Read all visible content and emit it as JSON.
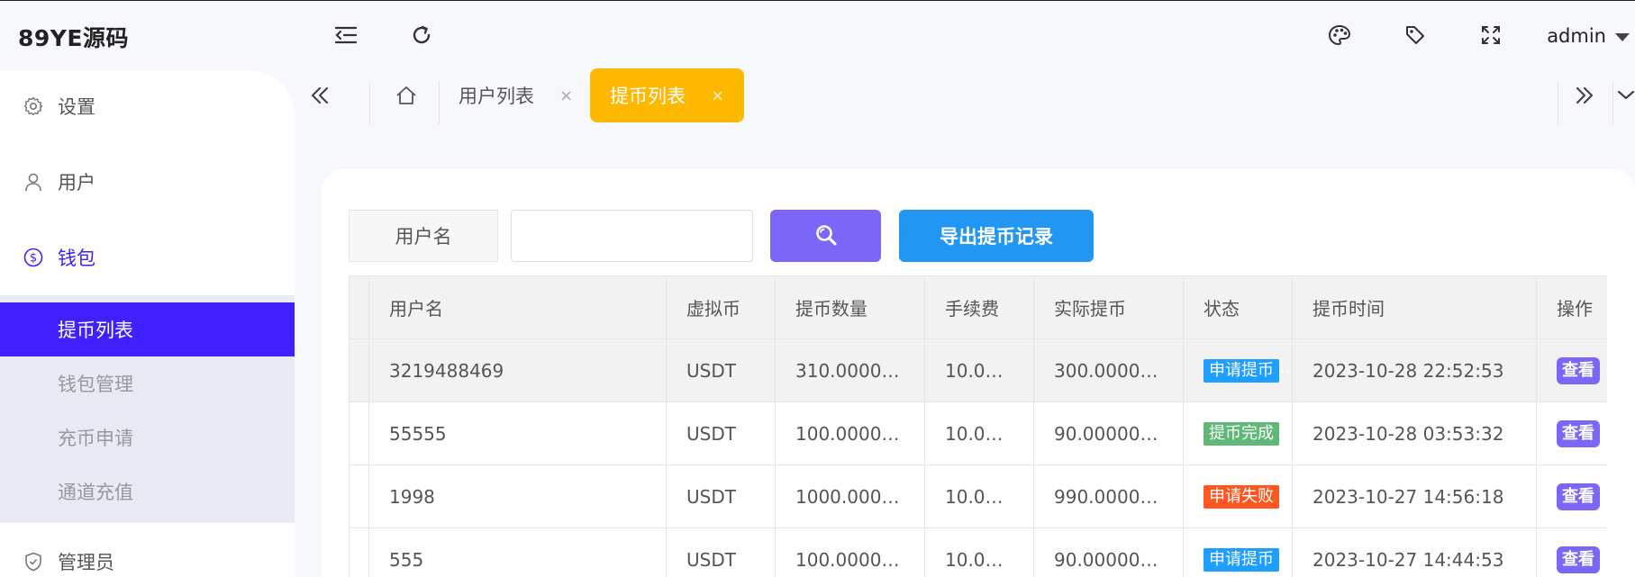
{
  "app": {
    "brand": "89YE源码"
  },
  "header": {
    "user": "admin",
    "icons": [
      "menu-fold-icon",
      "refresh-icon",
      "palette-icon",
      "tag-icon",
      "fullscreen-icon"
    ]
  },
  "sidebar": {
    "items": [
      {
        "label": "设置",
        "icon": "gear-icon"
      },
      {
        "label": "用户",
        "icon": "user-icon"
      },
      {
        "label": "钱包",
        "icon": "dollar-circle-icon"
      },
      {
        "label": "管理员",
        "icon": "shield-check-icon"
      }
    ],
    "wallet_sub": [
      {
        "label": "提币列表",
        "active": true
      },
      {
        "label": "钱包管理"
      },
      {
        "label": "充币申请"
      },
      {
        "label": "通道充值"
      }
    ]
  },
  "tabs": {
    "items": [
      {
        "label": "用户列表",
        "close": "×"
      },
      {
        "label": "提币列表",
        "close": "×",
        "active": true
      }
    ]
  },
  "search": {
    "label": "用户名",
    "value": "",
    "placeholder": "",
    "export_label": "导出提币记录"
  },
  "table": {
    "columns": [
      "用户名",
      "虚拟币",
      "提币数量",
      "手续费",
      "实际提币",
      "状态",
      "提币时间",
      "操作"
    ],
    "rows": [
      {
        "username": "3219488469",
        "coin": "USDT",
        "amount": "310.00000000",
        "fee": "10.0000",
        "actual": "300.00000000",
        "status": "申请提币",
        "status_color": "#1e9fff",
        "time": "2023-10-28 22:52:53",
        "action": "查看"
      },
      {
        "username": "55555",
        "coin": "USDT",
        "amount": "100.00000000",
        "fee": "10.0000",
        "actual": "90.00000000",
        "status": "提币完成",
        "status_color": "#5fb878",
        "time": "2023-10-28 03:53:32",
        "action": "查看"
      },
      {
        "username": "1998",
        "coin": "USDT",
        "amount": "1000.00000000",
        "fee": "10.0000",
        "actual": "990.00000000",
        "status": "申请失败",
        "status_color": "#ff5722",
        "time": "2023-10-27 14:56:18",
        "action": "查看"
      },
      {
        "username": "555",
        "coin": "USDT",
        "amount": "100.00000000",
        "fee": "10.0000",
        "actual": "90.00000000",
        "status": "申请提币",
        "status_color": "#1e9fff",
        "time": "2023-10-27 14:44:53",
        "action": "查看"
      }
    ]
  },
  "colors": {
    "accent": "#4120ff",
    "tab_active": "#ffb800",
    "search_button": "#7a66f7",
    "export_button": "#2196f3"
  }
}
